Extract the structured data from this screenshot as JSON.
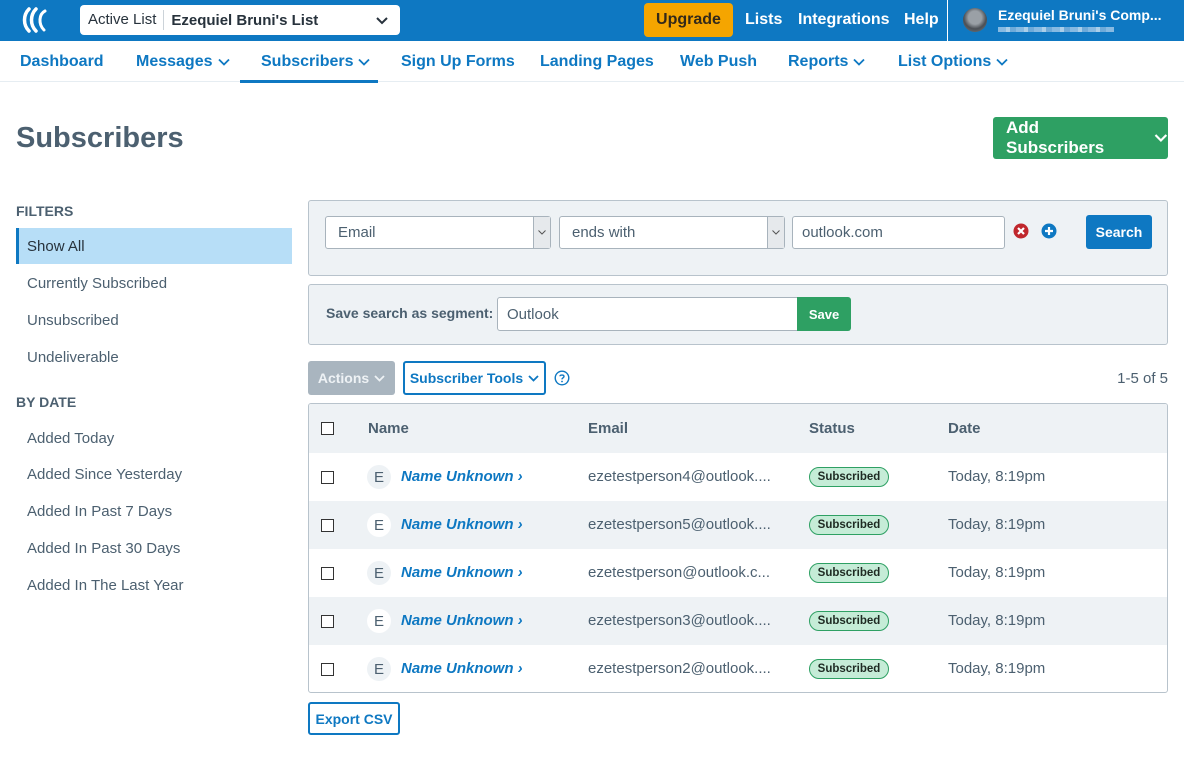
{
  "topbar": {
    "active_list_label": "Active List",
    "active_list_value": "Ezequiel Bruni's List",
    "upgrade": "Upgrade",
    "links": [
      "Lists",
      "Integrations",
      "Help"
    ],
    "account_name": "Ezequiel Bruni's Comp..."
  },
  "nav": {
    "items": [
      {
        "label": "Dashboard",
        "dropdown": false
      },
      {
        "label": "Messages",
        "dropdown": true
      },
      {
        "label": "Subscribers",
        "dropdown": true,
        "active": true
      },
      {
        "label": "Sign Up Forms",
        "dropdown": false
      },
      {
        "label": "Landing Pages",
        "dropdown": false
      },
      {
        "label": "Web Push",
        "dropdown": false
      },
      {
        "label": "Reports",
        "dropdown": true
      },
      {
        "label": "List Options",
        "dropdown": true
      }
    ]
  },
  "page": {
    "title": "Subscribers",
    "add_button": "Add Subscribers"
  },
  "sidebar": {
    "filters_heading": "FILTERS",
    "filters": [
      "Show All",
      "Currently Subscribed",
      "Unsubscribed",
      "Undeliverable"
    ],
    "active_filter": "Show All",
    "by_date_heading": "BY DATE",
    "by_date": [
      "Added Today",
      "Added Since Yesterday",
      "Added In Past 7 Days",
      "Added In Past 30 Days",
      "Added In The Last Year"
    ]
  },
  "search": {
    "field": "Email",
    "operator": "ends with",
    "value": "outlook.com",
    "button": "Search"
  },
  "segment": {
    "label": "Save search as segment:",
    "value": "Outlook",
    "save": "Save"
  },
  "toolbar": {
    "actions": "Actions",
    "subscriber_tools": "Subscriber Tools",
    "pager": "1-5 of 5"
  },
  "table": {
    "columns": [
      "Name",
      "Email",
      "Status",
      "Date"
    ],
    "rows": [
      {
        "initial": "E",
        "name": "Name Unknown",
        "email": "ezetestperson4@outlook....",
        "status": "Subscribed",
        "date": "Today, 8:19pm"
      },
      {
        "initial": "E",
        "name": "Name Unknown",
        "email": "ezetestperson5@outlook....",
        "status": "Subscribed",
        "date": "Today, 8:19pm"
      },
      {
        "initial": "E",
        "name": "Name Unknown",
        "email": "ezetestperson@outlook.c...",
        "status": "Subscribed",
        "date": "Today, 8:19pm"
      },
      {
        "initial": "E",
        "name": "Name Unknown",
        "email": "ezetestperson3@outlook....",
        "status": "Subscribed",
        "date": "Today, 8:19pm"
      },
      {
        "initial": "E",
        "name": "Name Unknown",
        "email": "ezetestperson2@outlook....",
        "status": "Subscribed",
        "date": "Today, 8:19pm"
      }
    ]
  },
  "footer": {
    "export": "Export CSV"
  },
  "colors": {
    "brand_blue": "#0e78c2",
    "upgrade_orange": "#f5a500",
    "success_green": "#2ea063",
    "active_filter_bg": "#b7def7"
  }
}
